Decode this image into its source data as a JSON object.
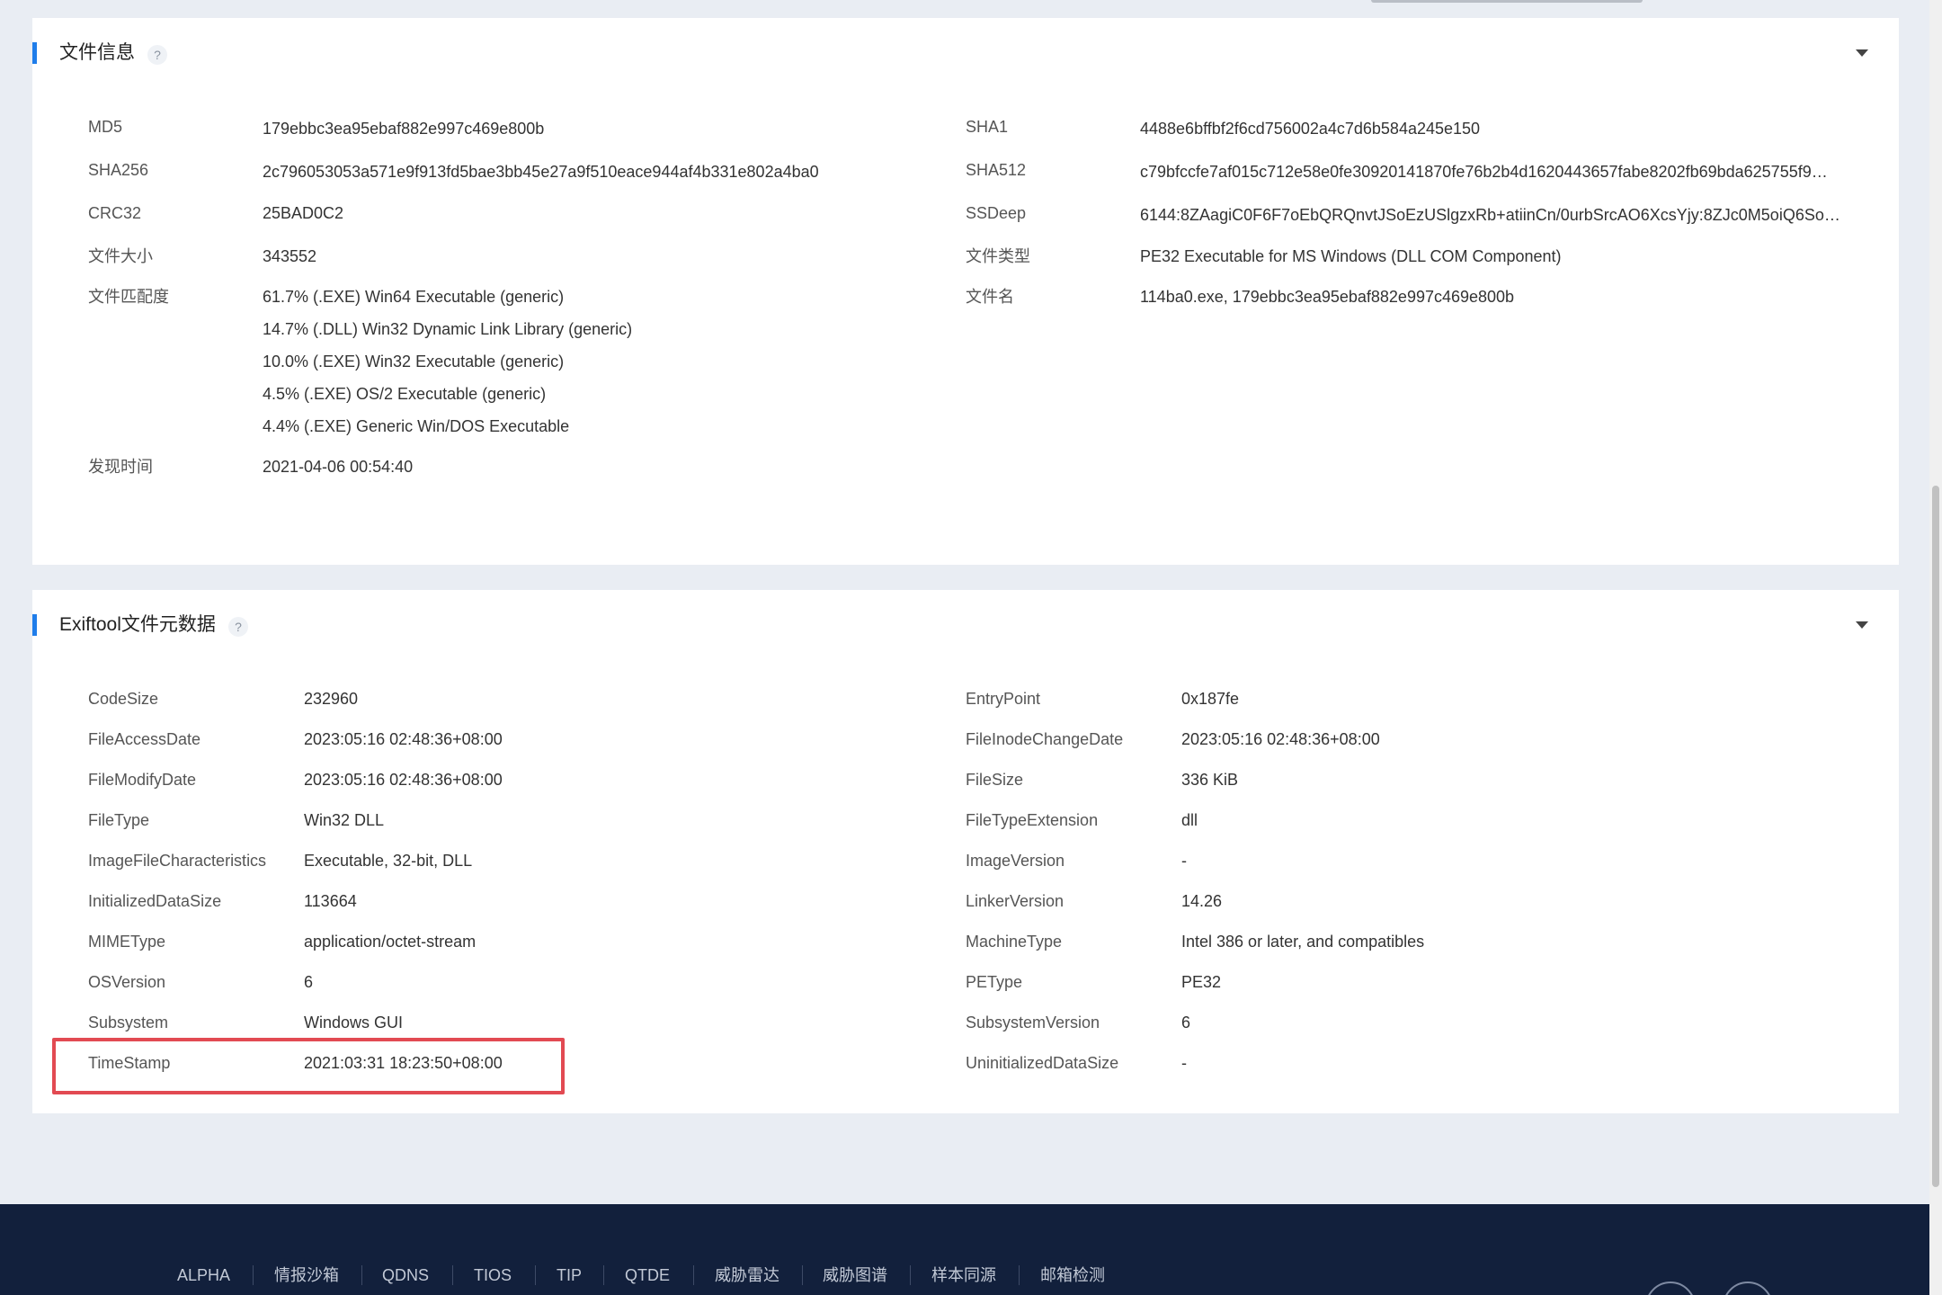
{
  "file_info": {
    "title": "文件信息",
    "help": "?",
    "left": [
      {
        "label": "MD5",
        "value": "179ebbc3ea95ebaf882e997c469e800b"
      },
      {
        "label": "SHA256",
        "value": "2c796053053a571e9f913fd5bae3bb45e27a9f510eace944af4b331e802a4ba0"
      },
      {
        "label": "CRC32",
        "value": "25BAD0C2"
      },
      {
        "label": "文件大小",
        "value": "343552"
      },
      {
        "label": "文件匹配度",
        "values": [
          "61.7% (.EXE) Win64 Executable (generic)",
          "14.7% (.DLL) Win32 Dynamic Link Library (generic)",
          "10.0% (.EXE) Win32 Executable (generic)",
          "4.5% (.EXE) OS/2 Executable (generic)",
          "4.4% (.EXE) Generic Win/DOS Executable"
        ]
      },
      {
        "label": "发现时间",
        "value": "2021-04-06 00:54:40"
      }
    ],
    "right": [
      {
        "label": "SHA1",
        "value": "4488e6bffbf2f6cd756002a4c7d6b584a245e150"
      },
      {
        "label": "SHA512",
        "value": "c79bfccfe7af015c712e58e0fe30920141870fe76b2b4d1620443657fabe8202fb69bda625755f9…"
      },
      {
        "label": "SSDeep",
        "value": "6144:8ZAagiC0F6F7oEbQRQnvtJSoEzUSlgzxRb+atiinCn/0urbSrcAO6XcsYjy:8ZJc0M5oiQ6So…"
      },
      {
        "label": "文件类型",
        "value": "PE32 Executable for MS Windows (DLL COM Component)"
      },
      {
        "label": "文件名",
        "value": "114ba0.exe, 179ebbc3ea95ebaf882e997c469e800b"
      }
    ]
  },
  "exiftool": {
    "title": "Exiftool文件元数据",
    "help": "?",
    "left": [
      {
        "label": "CodeSize",
        "value": "232960"
      },
      {
        "label": "FileAccessDate",
        "value": "2023:05:16 02:48:36+08:00"
      },
      {
        "label": "FileModifyDate",
        "value": "2023:05:16 02:48:36+08:00"
      },
      {
        "label": "FileType",
        "value": "Win32 DLL"
      },
      {
        "label": "ImageFileCharacteristics",
        "value": "Executable, 32-bit, DLL"
      },
      {
        "label": "InitializedDataSize",
        "value": "113664"
      },
      {
        "label": "MIMEType",
        "value": "application/octet-stream"
      },
      {
        "label": "OSVersion",
        "value": "6"
      },
      {
        "label": "Subsystem",
        "value": "Windows GUI"
      },
      {
        "label": "TimeStamp",
        "value": "2021:03:31 18:23:50+08:00"
      }
    ],
    "right": [
      {
        "label": "EntryPoint",
        "value": "0x187fe"
      },
      {
        "label": "FileInodeChangeDate",
        "value": "2023:05:16 02:48:36+08:00"
      },
      {
        "label": "FileSize",
        "value": "336 KiB"
      },
      {
        "label": "FileTypeExtension",
        "value": "dll"
      },
      {
        "label": "ImageVersion",
        "value": "-"
      },
      {
        "label": "LinkerVersion",
        "value": "14.26"
      },
      {
        "label": "MachineType",
        "value": "Intel 386 or later, and compatibles"
      },
      {
        "label": "PEType",
        "value": "PE32"
      },
      {
        "label": "SubsystemVersion",
        "value": "6"
      },
      {
        "label": "UninitializedDataSize",
        "value": "-"
      }
    ]
  },
  "footer": {
    "links": [
      "ALPHA",
      "情报沙箱",
      "QDNS",
      "TIOS",
      "TIP",
      "QTDE",
      "威胁雷达",
      "威胁图谱",
      "样本同源",
      "邮箱检测"
    ]
  },
  "colors": {
    "accent": "#1f7dea",
    "highlight": "#e24a52",
    "footer_bg": "#12203c"
  }
}
